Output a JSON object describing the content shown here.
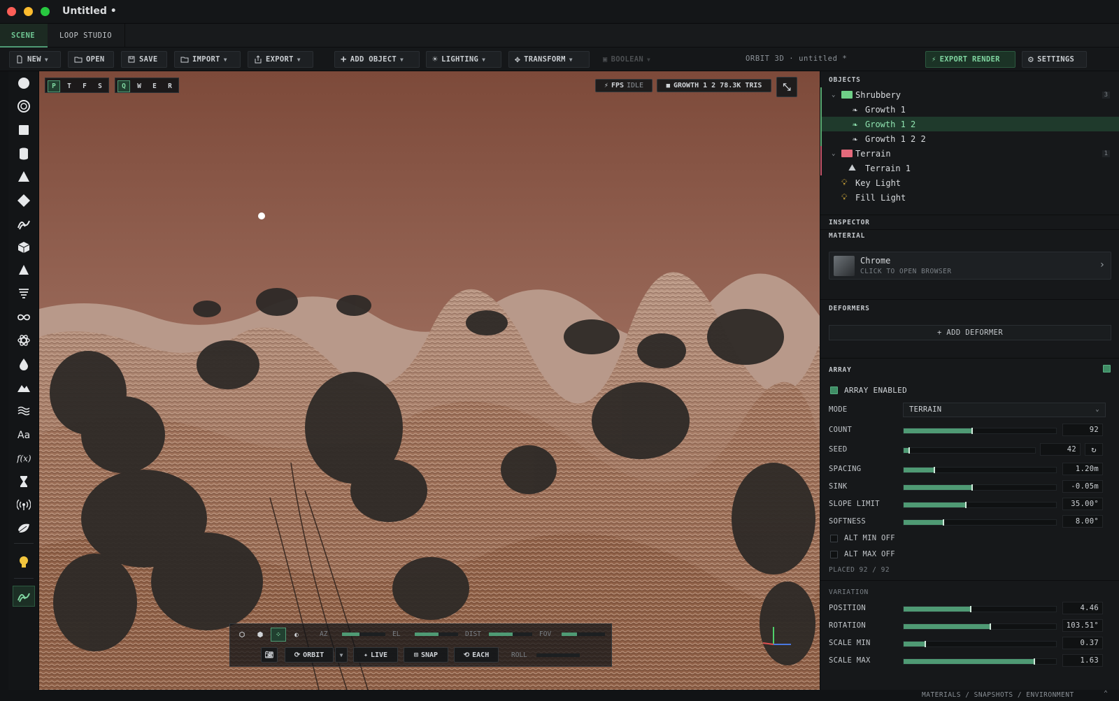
{
  "window": {
    "title": "Untitled •"
  },
  "tabs": [
    {
      "label": "SCENE",
      "active": true
    },
    {
      "label": "LOOP STUDIO",
      "active": false
    }
  ],
  "toolbar": {
    "new": "NEW",
    "open": "OPEN",
    "save": "SAVE",
    "import": "IMPORT",
    "export": "EXPORT",
    "add_object": "ADD OBJECT",
    "lighting": "LIGHTING",
    "transform": "TRANSFORM",
    "boolean": "BOOLEAN",
    "app_status": "ORBIT 3D · untitled *",
    "export_render": "EXPORT RENDER",
    "settings": "SETTINGS"
  },
  "left_tools": [
    "sphere-icon",
    "torus-icon",
    "cube-icon",
    "cylinder-icon",
    "cone-icon",
    "diamond-icon",
    "brush-stroke-icon",
    "box-3d-icon",
    "pyramid-icon",
    "tornado-icon",
    "infinity-icon",
    "atom-icon",
    "droplet-icon",
    "mountains-icon",
    "waves-icon",
    "text-icon",
    "function-icon",
    "hourglass-icon",
    "broadcast-icon",
    "leaf-icon",
    "light-bulb-icon",
    "curve-tool-icon"
  ],
  "text_tool_label": "Aa",
  "func_tool_label": "f(x)",
  "viewport": {
    "view_modes": [
      "P",
      "T",
      "F",
      "S"
    ],
    "gizmo_modes": [
      "Q",
      "W",
      "E",
      "R"
    ],
    "fps_label": "FPS",
    "fps_value": "IDLE",
    "stats": "GROWTH 1 2 78.3K TRIS",
    "cam_labels": {
      "az": "AZ",
      "el": "EL",
      "dist": "DIST",
      "fov": "FOV",
      "roll": "ROLL"
    },
    "cam_values": {
      "az": 0.4,
      "el": 0.55,
      "dist": 0.55,
      "fov": 0.35,
      "roll": 0.0
    },
    "orbit": "ORBIT",
    "live": "LIVE",
    "snap": "SNAP",
    "each": "EACH"
  },
  "objects": {
    "header": "OBJECTS",
    "groups": [
      {
        "name": "Shrubbery",
        "count": "3",
        "color": "#67c27d",
        "items": [
          "Growth 1",
          "Growth 1 2",
          "Growth 1 2 2"
        ]
      },
      {
        "name": "Terrain",
        "count": "1",
        "color": "#e05a6e",
        "items": [
          "Terrain 1"
        ]
      }
    ],
    "lights": [
      "Key Light",
      "Fill Light"
    ],
    "selected": "Growth 1 2"
  },
  "inspector": {
    "header": "INSPECTOR",
    "material_header": "MATERIAL",
    "material_name": "Chrome",
    "material_hint": "CLICK TO OPEN BROWSER",
    "deformers_header": "DEFORMERS",
    "add_deformer": "+ ADD DEFORMER"
  },
  "array": {
    "header": "ARRAY",
    "enabled_label": "ARRAY ENABLED",
    "enabled": true,
    "mode_label": "MODE",
    "mode_value": "TERRAIN",
    "params": [
      {
        "label": "COUNT",
        "value": "92",
        "fill": 0.45
      },
      {
        "label": "SEED",
        "value": "42",
        "fill": 0.04
      },
      {
        "label": "SPACING",
        "value": "1.20m",
        "fill": 0.2
      },
      {
        "label": "SINK",
        "value": "-0.05m",
        "fill": 0.45
      },
      {
        "label": "SLOPE LIMIT",
        "value": "35.00°",
        "fill": 0.41
      },
      {
        "label": "SOFTNESS",
        "value": "8.00°",
        "fill": 0.26
      }
    ],
    "alt_min": "ALT MIN OFF",
    "alt_max": "ALT MAX OFF",
    "placed": "PLACED 92 / 92",
    "variation_header": "VARIATION",
    "variation": [
      {
        "label": "POSITION",
        "value": "4.46",
        "fill": 0.44
      },
      {
        "label": "ROTATION",
        "value": "103.51°",
        "fill": 0.57
      },
      {
        "label": "SCALE MIN",
        "value": "0.37",
        "fill": 0.14
      },
      {
        "label": "SCALE MAX",
        "value": "1.63",
        "fill": 0.86
      }
    ]
  },
  "bottom": {
    "links": "MATERIALS / SNAPSHOTS / ENVIRONMENT"
  },
  "colors": {
    "accent": "#4f9a74",
    "selected_row": "#1f3a2c",
    "bg": "#16181a"
  }
}
